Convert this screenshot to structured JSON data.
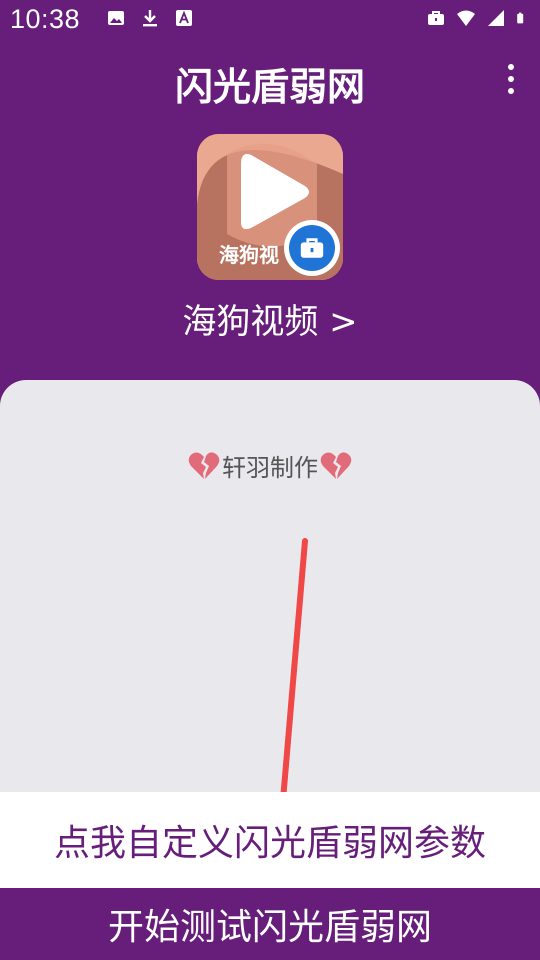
{
  "status_bar": {
    "time": "10:38",
    "left_icons": [
      "image-icon",
      "download-icon",
      "font-icon"
    ],
    "right_icons": [
      "briefcase-icon",
      "wifi-icon",
      "signal-icon",
      "battery-icon"
    ]
  },
  "app_bar": {
    "title": "闪光盾弱网",
    "menu_icon": "overflow-menu-icon"
  },
  "selected_app": {
    "name": "海狗视频 >",
    "icon_text": "海狗视",
    "badge_icon": "work-profile-briefcase-icon"
  },
  "credit": {
    "text": "轩羽制作",
    "decoration_icon": "broken-heart-icon"
  },
  "buttons": {
    "custom_params": "点我自定义闪光盾弱网参数",
    "start_test": "开始测试闪光盾弱网"
  },
  "colors": {
    "primary": "#661e7a",
    "panel": "#e9e8ed",
    "arrow": "#f04747",
    "badge": "#1f74d6"
  }
}
